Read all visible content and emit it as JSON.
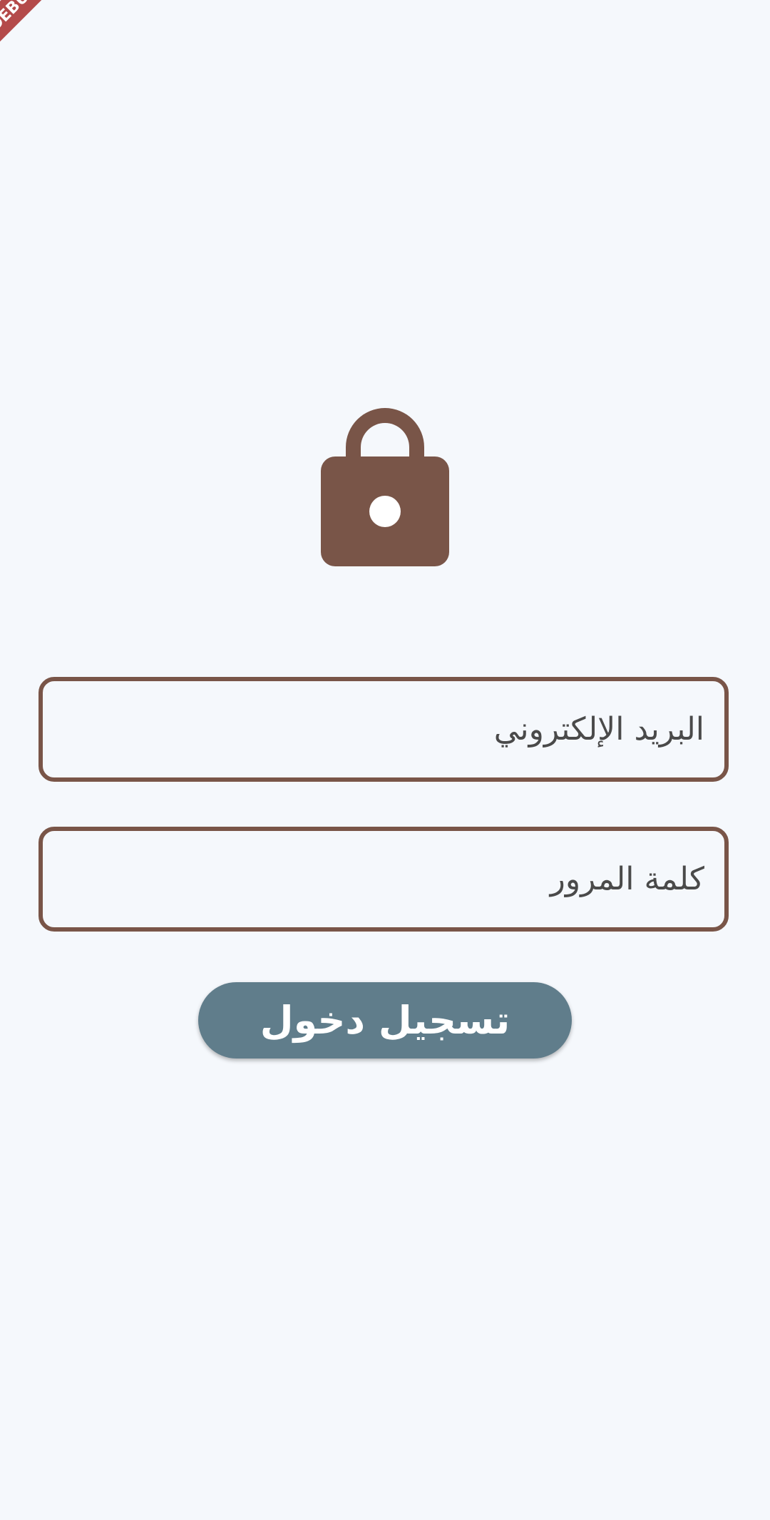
{
  "debug_banner": {
    "label": "DEBUG"
  },
  "lock": {
    "icon": "lock-icon",
    "color": "#795548"
  },
  "email": {
    "placeholder": "البريد الإلكتروني",
    "value": ""
  },
  "password": {
    "placeholder": "كلمة المرور",
    "value": ""
  },
  "login_button": {
    "label": "تسجيل دخول"
  },
  "colors": {
    "background": "#f5f8fc",
    "accent": "#795548",
    "button": "#607d8b",
    "button_text": "#ffffff",
    "banner": "#b44a4a"
  }
}
